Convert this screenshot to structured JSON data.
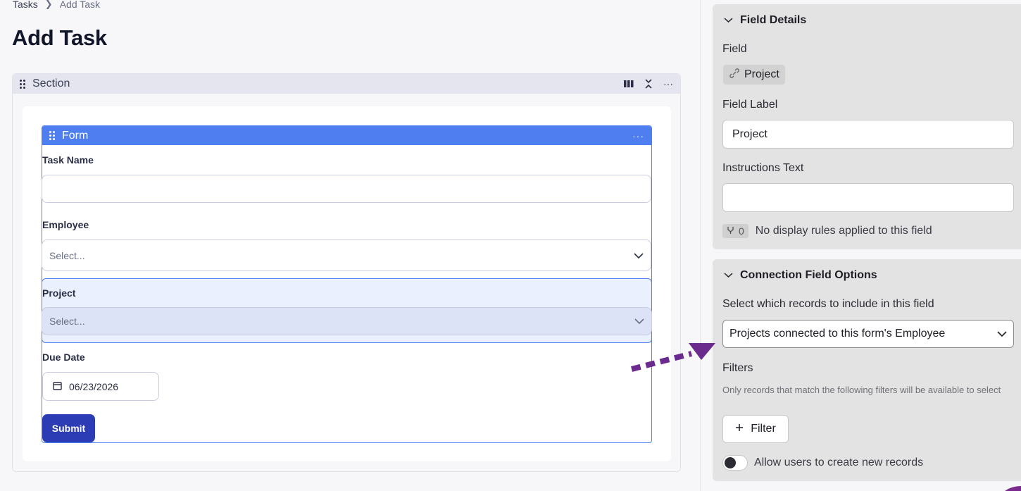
{
  "breadcrumb": {
    "parent": "Tasks",
    "current": "Add Task"
  },
  "page": {
    "title": "Add Task"
  },
  "section": {
    "title": "Section"
  },
  "form": {
    "title": "Form",
    "more": "···",
    "task_name_label": "Task Name",
    "employee_label": "Employee",
    "employee_placeholder": "Select...",
    "project_label": "Project",
    "project_placeholder": "Select...",
    "due_date_label": "Due Date",
    "due_date_value": "06/23/2026",
    "submit_label": "Submit"
  },
  "field_details": {
    "heading": "Field Details",
    "field_label": "Field",
    "field_chip": "Project",
    "field_label_title": "Field Label",
    "field_label_value": "Project",
    "instructions_title": "Instructions Text",
    "instructions_value": "",
    "rules_count": "0",
    "rules_text": "No display rules applied to this field"
  },
  "connection_options": {
    "heading": "Connection Field Options",
    "records_label": "Select which records to include in this field",
    "records_value": "Projects connected to this form's Employee",
    "filters_title": "Filters",
    "filters_help": "Only records that match the following filters will be available to select",
    "filter_button": "Filter",
    "allow_create_label": "Allow users to create new records",
    "allow_create_on": false
  },
  "colors": {
    "form_accent": "#4f7ef0",
    "submit": "#2c3cb5",
    "arrow": "#6a2a8e"
  }
}
